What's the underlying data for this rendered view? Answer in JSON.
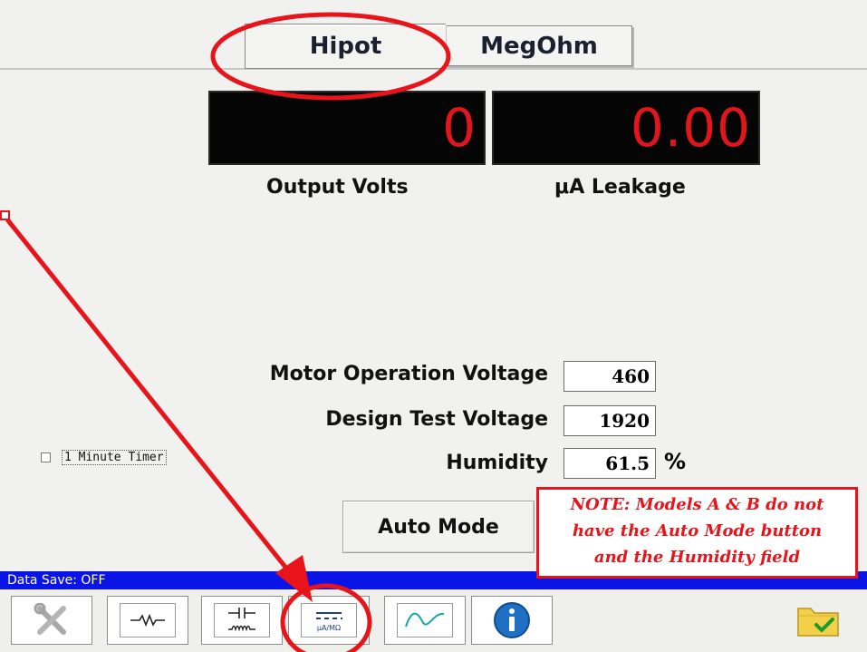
{
  "tabs": [
    {
      "label": "Hipot",
      "active": true
    },
    {
      "label": "MegOhm",
      "active": false
    }
  ],
  "displays": {
    "output_volts": {
      "value": "0",
      "label": "Output Volts"
    },
    "leakage": {
      "value": "0.00",
      "label": "μA Leakage"
    }
  },
  "fields": [
    {
      "label": "Motor Operation Voltage",
      "value": "460"
    },
    {
      "label": "Design Test Voltage",
      "value": "1920"
    },
    {
      "label": "Humidity",
      "value": "61.5",
      "unit": "%"
    }
  ],
  "timer": {
    "label": "1 Minute Timer",
    "checked": false
  },
  "auto_mode": {
    "label": "Auto Mode"
  },
  "note": {
    "line1": "NOTE: Models A & B do not",
    "line2": "have the Auto Mode button",
    "line3": "and the Humidity field"
  },
  "status": {
    "text": "Data Save: OFF"
  },
  "toolbar": {
    "buttons": [
      {
        "icon": "tools-icon"
      },
      {
        "icon": "resistor-icon"
      },
      {
        "icon": "capacitor-inductor-icon"
      },
      {
        "icon": "dc-microamp-megohm-icon",
        "caption": "μA/MΩ"
      },
      {
        "icon": "waveform-icon"
      },
      {
        "icon": "info-icon"
      },
      {
        "icon": "folder-check-icon"
      }
    ]
  },
  "colors": {
    "display_digits": "#e0161b",
    "annotation_red": "#e8141a",
    "status_bar": "#0a14e6"
  }
}
